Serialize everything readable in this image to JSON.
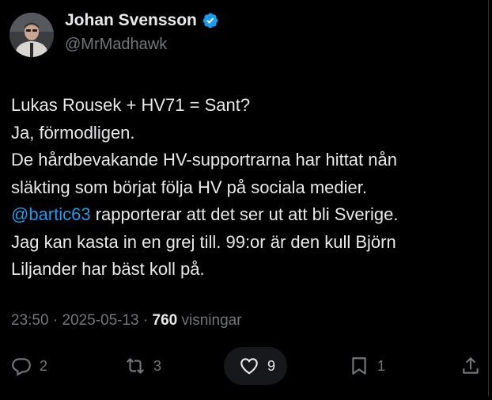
{
  "author": {
    "name": "Johan Svensson",
    "handle": "@MrMadhawk",
    "verified": true
  },
  "tweet": {
    "line1": "Lukas Rousek + HV71 = Sant?",
    "line2": "Ja, förmodligen.",
    "line3": "De hårdbevakande HV-supportrarna har hittat nån",
    "line4": "släkting som börjat följa HV på sociala medier.",
    "line5_mention": "@bartic63",
    "line5_rest": " rapporterar att det ser ut att bli Sverige.",
    "line6": "Jag kan kasta in en grej till. 99:or är den kull Björn",
    "line7": "Liljander har bäst koll på."
  },
  "meta": {
    "time": "23:50",
    "sep1": " · ",
    "date": "2025-05-13",
    "sep2": " · ",
    "views_count": "760",
    "views_label": " visningar"
  },
  "actions": {
    "replies": "2",
    "reposts": "3",
    "likes": "9",
    "bookmarks": "1"
  },
  "colors": {
    "background": "#000000",
    "text": "#e7e9ea",
    "muted": "#71767b",
    "accent": "#1d9bf0"
  },
  "icons": [
    "verified-badge-icon",
    "reply-icon",
    "repost-icon",
    "like-icon",
    "bookmark-icon",
    "share-icon"
  ]
}
